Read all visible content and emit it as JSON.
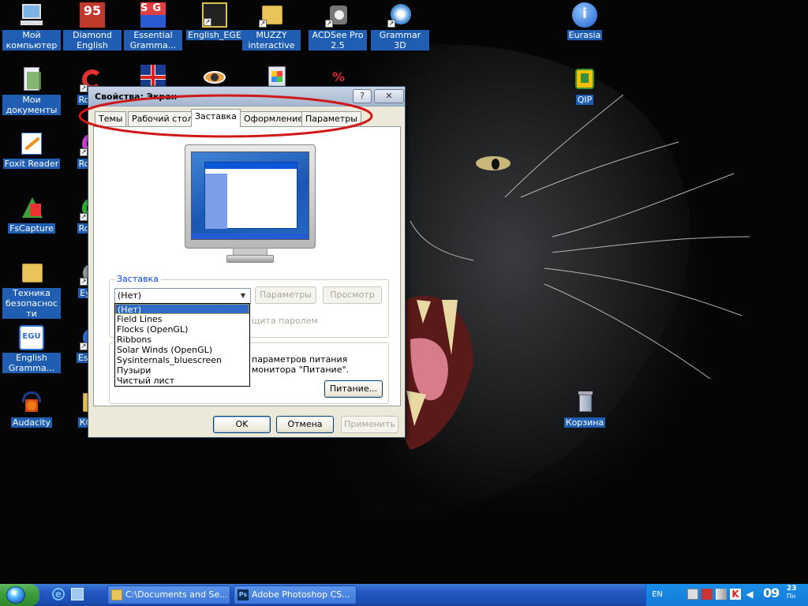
{
  "desktop_icons": [
    {
      "name": "icon-my-computer",
      "label": "Мой компьютер",
      "icon": "computer-icon",
      "color": "#7bb3e6"
    },
    {
      "name": "icon-diamond-english",
      "label": "Diamond English",
      "icon": "diamond-english-icon",
      "color": "#c0392b",
      "text": "95"
    },
    {
      "name": "icon-essential-grammar",
      "label": "Essential Gramma...",
      "icon": "essential-grammar-icon",
      "color": "#e04040",
      "text": "SG"
    },
    {
      "name": "icon-english-ege",
      "label": "English_EGE",
      "icon": "english-ege-icon",
      "color": "#333"
    },
    {
      "name": "icon-muzzy",
      "label": "MUZZY interactive",
      "icon": "folder-icon",
      "color": "#e8c45a"
    },
    {
      "name": "icon-acdsee",
      "label": "ACDSee Pro 2.5",
      "icon": "acdsee-icon",
      "color": "#666"
    },
    {
      "name": "icon-grammar-3d",
      "label": "Grammar 3D",
      "icon": "grammar-3d-icon",
      "color": "#4a90d9"
    },
    {
      "name": "icon-eurasia",
      "label": "Eurasia",
      "icon": "info-globe-icon",
      "color": "#3a7bd5",
      "text": "i"
    },
    {
      "name": "icon-my-documents",
      "label": "Мои документы",
      "icon": "documents-icon",
      "color": "#6aa84f"
    },
    {
      "name": "icon-round-1",
      "label": "Round",
      "icon": "round-icon",
      "color": "#e03030"
    },
    {
      "name": "icon-union-flag",
      "label": "",
      "icon": "union-flag-icon",
      "color": "#1a3d8f"
    },
    {
      "name": "icon-eye",
      "label": "",
      "icon": "eye-icon",
      "color": "#f0a040"
    },
    {
      "name": "icon-windows-media",
      "label": "",
      "icon": "installer-icon",
      "color": "#4da3ff"
    },
    {
      "name": "icon-sale",
      "label": "",
      "icon": "sale-icon",
      "color": "#d92b2b",
      "text": "%"
    },
    {
      "name": "icon-qip",
      "label": "QIP",
      "icon": "qip-icon",
      "color": "#f2c200"
    },
    {
      "name": "icon-foxit",
      "label": "Foxit Reader",
      "icon": "foxit-icon",
      "color": "#3a6fd8"
    },
    {
      "name": "icon-round-2",
      "label": "Round",
      "icon": "round-icon",
      "color": "#c640d0"
    },
    {
      "name": "icon-fscapture",
      "label": "FsCapture",
      "icon": "fscapture-icon",
      "color": "#3aa23a"
    },
    {
      "name": "icon-round-3",
      "label": "Round",
      "icon": "round-icon",
      "color": "#30b030"
    },
    {
      "name": "icon-security",
      "label": "Техника безопасности",
      "icon": "folder-icon",
      "color": "#e8c45a"
    },
    {
      "name": "icon-eye-game",
      "label": "Eye C",
      "icon": "eye-game-icon",
      "color": "#999"
    },
    {
      "name": "icon-english-grammar",
      "label": "English Gramma...",
      "icon": "egu-icon",
      "color": "#2b6ed2",
      "text": "EGU"
    },
    {
      "name": "icon-essential-2",
      "label": "Esse Gramm",
      "icon": "essential-icon",
      "color": "#2b6ed2"
    },
    {
      "name": "icon-audacity",
      "label": "Audacity",
      "icon": "audacity-icon",
      "color": "#f07a18"
    },
    {
      "name": "icon-konk",
      "label": "КОНК",
      "icon": "folder-icon",
      "color": "#e8c45a"
    },
    {
      "name": "icon-recycle-bin",
      "label": "Корзина",
      "icon": "recycle-bin-icon",
      "color": "#8aa0b8"
    }
  ],
  "dialog": {
    "title": "Свойства: Экран",
    "help_label": "?",
    "close_label": "✕",
    "tabs": [
      {
        "label": "Темы"
      },
      {
        "label": "Рабочий стол"
      },
      {
        "label": "Заставка"
      },
      {
        "label": "Оформление"
      },
      {
        "label": "Параметры"
      }
    ],
    "screensaver": {
      "legend": "Заставка",
      "selected": "(Нет)",
      "options": [
        "(Нет)",
        "Field Lines",
        "Flocks (OpenGL)",
        "Ribbons",
        "Solar Winds (OpenGL)",
        "Sysinternals_bluescreen",
        "Пузыри",
        "Чистый лист"
      ],
      "settings_label": "Параметры",
      "preview_label": "Просмотр",
      "password_text": "щита паролем"
    },
    "power": {
      "text": "параметров питания монитора \"Питание\".",
      "button": "Питание..."
    },
    "ok_label": "OK",
    "cancel_label": "Отмена",
    "apply_label": "Применить"
  },
  "taskbar": {
    "tasks": [
      {
        "label": "C:\\Documents and Se..."
      },
      {
        "label": "Adobe Photoshop CS..."
      }
    ],
    "lang": "EN",
    "clock": "09",
    "clock_minutes": "23",
    "clock_sub": "Пн"
  },
  "colors": {
    "annotation": "#d01818",
    "titlebar": "#b0c0d6",
    "taskbar": "#2459c2",
    "selection": "#316ac5"
  }
}
